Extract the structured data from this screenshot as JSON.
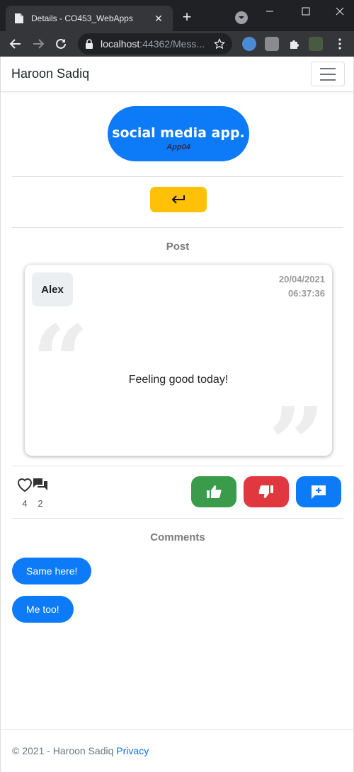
{
  "browser": {
    "tab_title": "Details - CO453_WebApps",
    "url_host": "localhost",
    "url_rest": ":44362/Mess..."
  },
  "navbar": {
    "brand": "Haroon Sadiq"
  },
  "logo": {
    "title": "social media app.",
    "subtitle": "App04",
    "color": "#0d7bf8"
  },
  "post_section": {
    "heading": "Post"
  },
  "post": {
    "author": "Alex",
    "date": "20/04/2021",
    "time": "06:37:36",
    "text": "Feeling good today!"
  },
  "stats": {
    "likes": "4",
    "comments": "2"
  },
  "actions": {
    "like_color": "#3a9b4a",
    "dislike_color": "#e0383e",
    "add_comment_color": "#0d7bf8"
  },
  "comments_section": {
    "heading": "Comments",
    "items": [
      "Same here!",
      "Me too!"
    ]
  },
  "footer": {
    "copyright": "© 2021 - Haroon Sadiq",
    "privacy_link": "Privacy"
  }
}
